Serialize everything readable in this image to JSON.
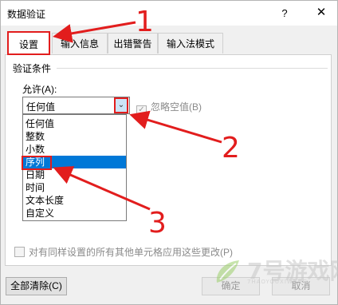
{
  "window": {
    "title": "数据验证",
    "help": "?",
    "close": "✕"
  },
  "tabs": [
    {
      "label": "设置",
      "active": true
    },
    {
      "label": "输入信息",
      "active": false
    },
    {
      "label": "出错警告",
      "active": false
    },
    {
      "label": "输入法模式",
      "active": false
    }
  ],
  "settings": {
    "section_title": "验证条件",
    "allow_label": "允许(A):",
    "allow_value": "任何值",
    "ignore_blank_label": "忽略空值(B)",
    "ignore_blank_checked": true,
    "options": [
      "任何值",
      "整数",
      "小数",
      "序列",
      "日期",
      "时间",
      "文本长度",
      "自定义"
    ],
    "selected_option": "序列",
    "apply_all_label": "对有同样设置的所有其他单元格应用这些更改(P)"
  },
  "buttons": {
    "clear_all": "全部清除(C)",
    "ok": "确定",
    "cancel": "取消"
  },
  "annotations": {
    "step1": "1",
    "step2": "2",
    "step3": "3",
    "color": "#e21d1d"
  },
  "watermark": {
    "text": "7号游戏网",
    "sub": "7HAOYOUXIWANG"
  }
}
